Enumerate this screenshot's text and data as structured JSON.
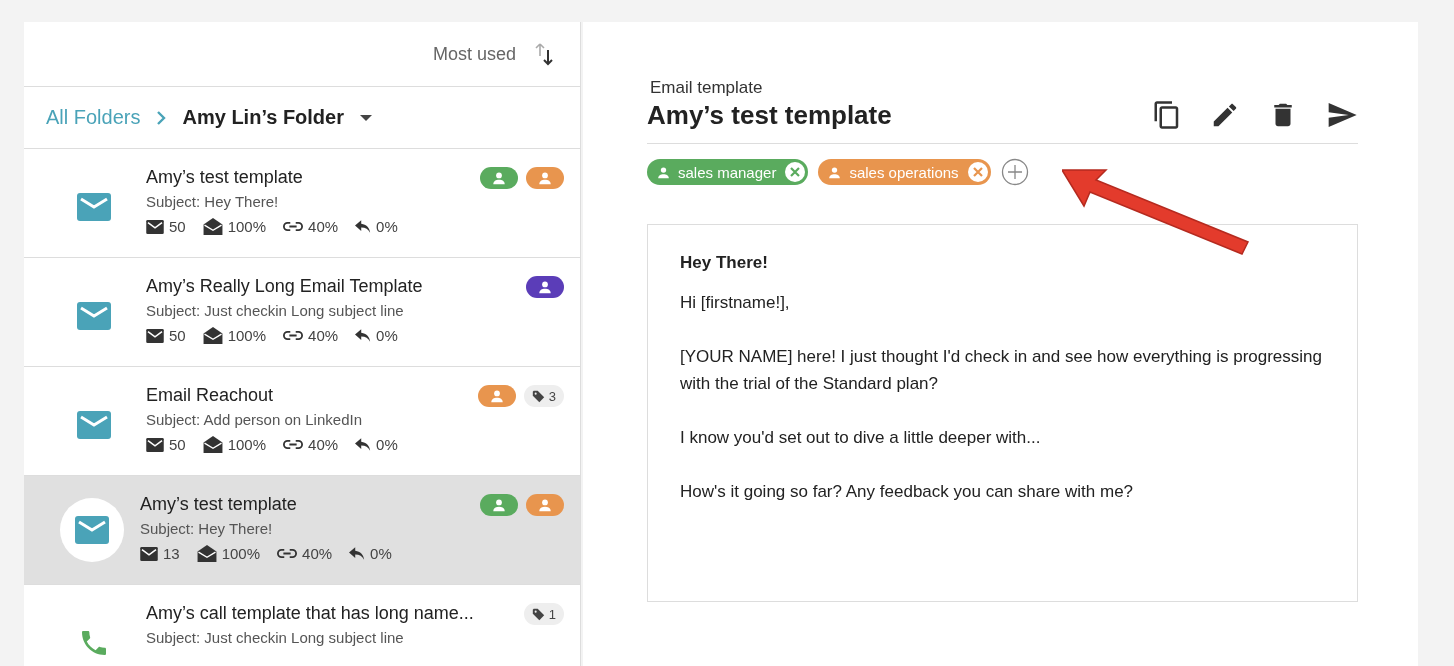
{
  "sort": {
    "label": "Most used"
  },
  "breadcrumb": {
    "root": "All Folders",
    "current": "Amy Lin’s Folder"
  },
  "templates": [
    {
      "kind": "email",
      "title": "Amy’s test template",
      "subject": "Subject: Hey There!",
      "selected": false,
      "stats": {
        "sent": "50",
        "opened": "100%",
        "clicked": "40%",
        "replied": "0%"
      },
      "badges": [
        {
          "kind": "role",
          "color": "#5aab5e"
        },
        {
          "kind": "role",
          "color": "#e8954e"
        }
      ]
    },
    {
      "kind": "email",
      "title": "Amy’s Really Long Email Template",
      "subject": "Subject: Just checkin Long subject line",
      "selected": false,
      "stats": {
        "sent": "50",
        "opened": "100%",
        "clicked": "40%",
        "replied": "0%"
      },
      "badges": [
        {
          "kind": "role",
          "color": "#5b3db8"
        }
      ]
    },
    {
      "kind": "email",
      "title": "Email Reachout",
      "subject": "Subject: Add person on LinkedIn",
      "selected": false,
      "stats": {
        "sent": "50",
        "opened": "100%",
        "clicked": "40%",
        "replied": "0%"
      },
      "badges": [
        {
          "kind": "role",
          "color": "#e8954e"
        },
        {
          "kind": "tag",
          "count": "3"
        }
      ]
    },
    {
      "kind": "email",
      "title": "Amy’s test template",
      "subject": "Subject: Hey There!",
      "selected": true,
      "stats": {
        "sent": "13",
        "opened": "100%",
        "clicked": "40%",
        "replied": "0%"
      },
      "badges": [
        {
          "kind": "role",
          "color": "#5aab5e"
        },
        {
          "kind": "role",
          "color": "#e8954e"
        }
      ]
    },
    {
      "kind": "call",
      "title": "Amy’s call template that has long name...",
      "subject": "Subject: Just checkin Long subject line",
      "selected": false,
      "badges": [
        {
          "kind": "tag",
          "count": "1"
        }
      ]
    }
  ],
  "detail": {
    "eyebrow": "Email template",
    "title": "Amy’s test template",
    "chips": [
      {
        "label": "sales manager",
        "color": "#5aab5e"
      },
      {
        "label": "sales operations",
        "color": "#e8954e"
      }
    ],
    "email": {
      "subject": "Hey There!",
      "paragraphs": [
        "Hi [firstname!],",
        "[YOUR NAME] here! I just thought I'd check in and see how everything is progressing with the trial of the Standard plan?",
        "I know you'd set out to dive a little deeper with...",
        "How's it going so far? Any feedback you can share with me?"
      ]
    }
  }
}
